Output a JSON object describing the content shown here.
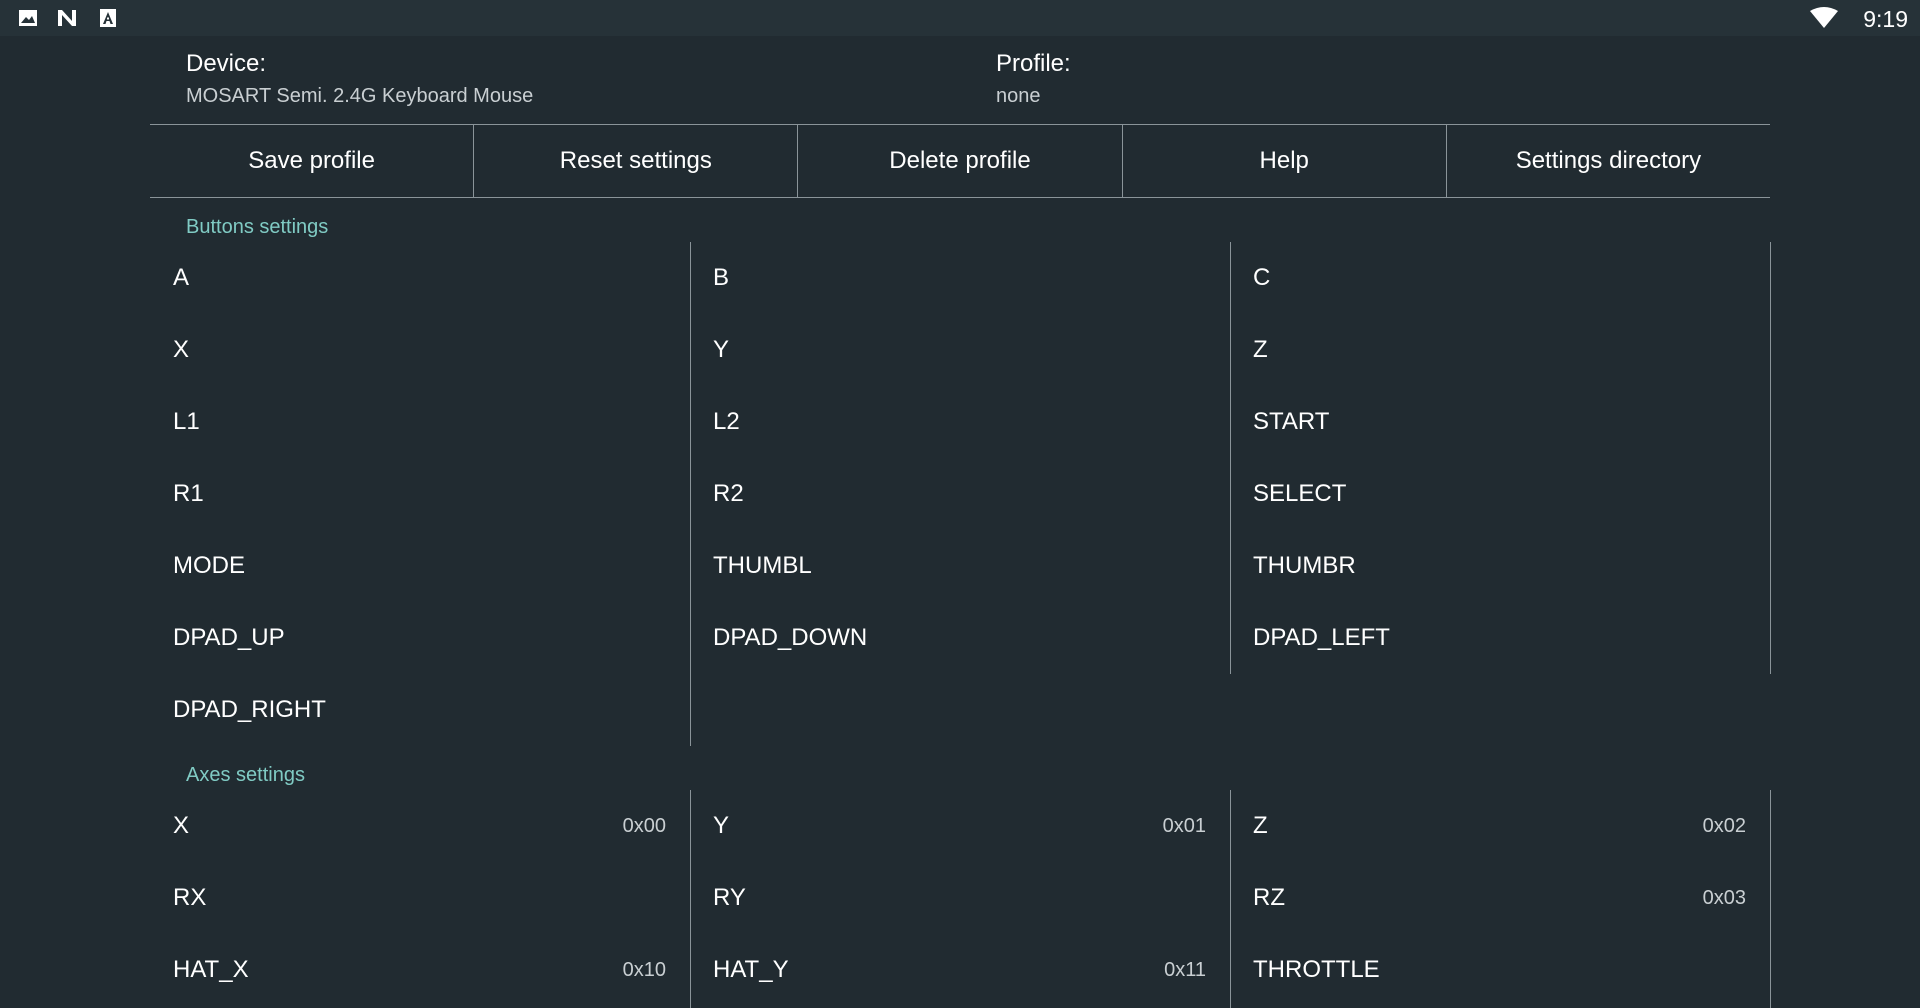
{
  "status_bar": {
    "time": "9:19",
    "icons": [
      "image-icon",
      "n-logo-icon",
      "a-box-icon"
    ],
    "wifi_icon": "wifi-icon"
  },
  "header": {
    "device_label": "Device:",
    "device_value": "MOSART Semi. 2.4G Keyboard Mouse",
    "profile_label": "Profile:",
    "profile_value": "none"
  },
  "toolbar": {
    "buttons": [
      "Save profile",
      "Reset settings",
      "Delete profile",
      "Help",
      "Settings directory"
    ]
  },
  "buttons_settings": {
    "title": "Buttons settings",
    "columns": [
      [
        "A",
        "X",
        "L1",
        "R1",
        "MODE",
        "DPAD_UP",
        "DPAD_RIGHT"
      ],
      [
        "B",
        "Y",
        "L2",
        "R2",
        "THUMBL",
        "DPAD_DOWN"
      ],
      [
        "C",
        "Z",
        "START",
        "SELECT",
        "THUMBR",
        "DPAD_LEFT"
      ]
    ]
  },
  "axes_settings": {
    "title": "Axes settings",
    "columns": [
      [
        {
          "label": "X",
          "value": "0x00"
        },
        {
          "label": "RX",
          "value": ""
        },
        {
          "label": "HAT_X",
          "value": "0x10"
        }
      ],
      [
        {
          "label": "Y",
          "value": "0x01"
        },
        {
          "label": "RY",
          "value": ""
        },
        {
          "label": "HAT_Y",
          "value": "0x11"
        }
      ],
      [
        {
          "label": "Z",
          "value": "0x02"
        },
        {
          "label": "RZ",
          "value": "0x03"
        },
        {
          "label": "THROTTLE",
          "value": ""
        }
      ]
    ]
  },
  "colors": {
    "background": "#212b31",
    "status_bar": "#263238",
    "section_title": "#80cbc4",
    "divider": "#8a9499"
  }
}
